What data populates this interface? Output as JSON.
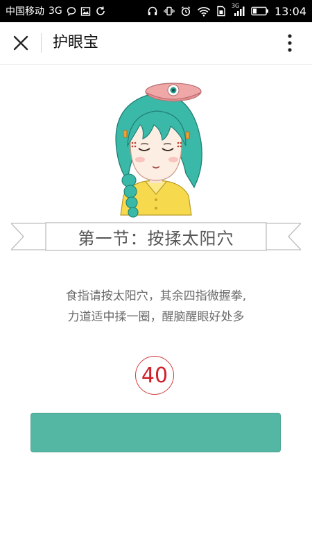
{
  "status_bar": {
    "carrier": "中国移动",
    "network": "3G",
    "signal_network": "3G",
    "time": "13:04",
    "icons": [
      "chat-bubble-icon",
      "image-icon",
      "sync-icon",
      "headphones-icon",
      "vibrate-icon",
      "alarm-icon",
      "wifi-icon",
      "sim-icon",
      "signal-icon",
      "battery-icon"
    ]
  },
  "title_bar": {
    "title": "护眼宝",
    "close_icon": "close-icon",
    "more_icon": "more-vertical-icon"
  },
  "exercise": {
    "section_title": "第一节：按揉太阳穴",
    "instruction_line1": "食指请按太阳穴，其余四指微握拳,",
    "instruction_line2": "力道适中揉一圈，醒脑醒眼好处多",
    "counter": "40",
    "action_label": ""
  },
  "colors": {
    "button": "#54b7a4",
    "counter": "#d0202a",
    "character_hair": "#3bb9a8",
    "character_shirt": "#f6d94d",
    "beret": "#f0a7a8"
  }
}
